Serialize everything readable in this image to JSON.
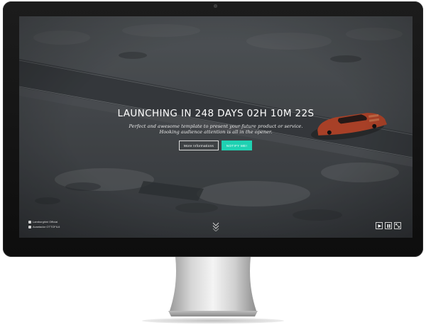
{
  "hero": {
    "countdown_title": "LAUNCHING IN 248 DAYS 02H 10M 22S",
    "subtitle_line1": "Perfect and awesome template to present your future product or service.",
    "subtitle_line2": "Hooking audience attention is all in the opener."
  },
  "buttons": {
    "more_info_label": "More Informations",
    "notify_label": "NOTIFY ME!"
  },
  "credits": {
    "line1": "Lamborghini Official",
    "line2": "Avantador OTTOFIL6"
  },
  "controls": {
    "play_icon": "play-icon",
    "pause_icon": "pause-icon",
    "fullscreen_icon": "fullscreen-icon"
  },
  "colors": {
    "accent": "#1fd1b2",
    "car": "#c84a2a",
    "bezel": "#111111"
  }
}
